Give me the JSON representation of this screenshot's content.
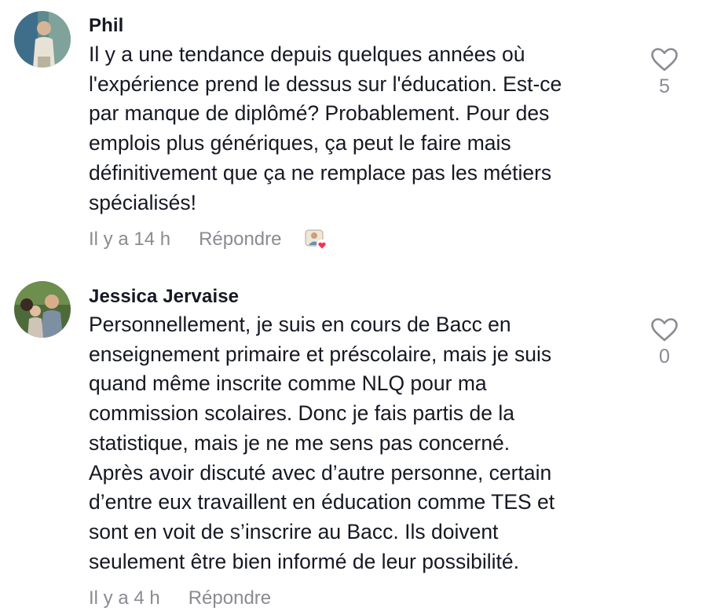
{
  "comments": [
    {
      "username": "Phil",
      "text": "Il y a une tendance depuis quelques années où\nl'expérience prend le dessus sur l'éducation. Est-ce\npar manque de diplômé? Probablement. Pour des\nemplois plus génériques, ça peut le faire mais\ndéfinitivement que ça ne remplace pas les métiers\nspécialisés!",
      "time": "Il y a 14 h",
      "reply_label": "Répondre",
      "likes": "5",
      "liked_by_creator": true,
      "avatar_icon": "user-avatar-photo"
    },
    {
      "username": "Jessica Jervaise",
      "text": "Personnellement, je suis en cours de Bacc en\nenseignement primaire et préscolaire, mais je suis\nquand même inscrite comme NLQ pour ma\ncommission scolaires. Donc je fais partis de la\nstatistique, mais je ne me sens pas concerné.\nAprès avoir discuté avec d’autre personne, certain\nd’entre eux travaillent en éducation comme TES et\nsont en voit de s’inscrire au Bacc. Ils doivent\nseulement être bien informé de leur possibilité.",
      "time": "Il y a 4 h",
      "reply_label": "Répondre",
      "likes": "0",
      "liked_by_creator": false,
      "avatar_icon": "user-avatar-photo"
    }
  ],
  "colors": {
    "text": "#161823",
    "muted": "#8a8b91",
    "heart_badge": "#fe2c55"
  },
  "icons": {
    "like": "heart-outline-icon",
    "creator_like": "creator-liked-badge-icon"
  }
}
